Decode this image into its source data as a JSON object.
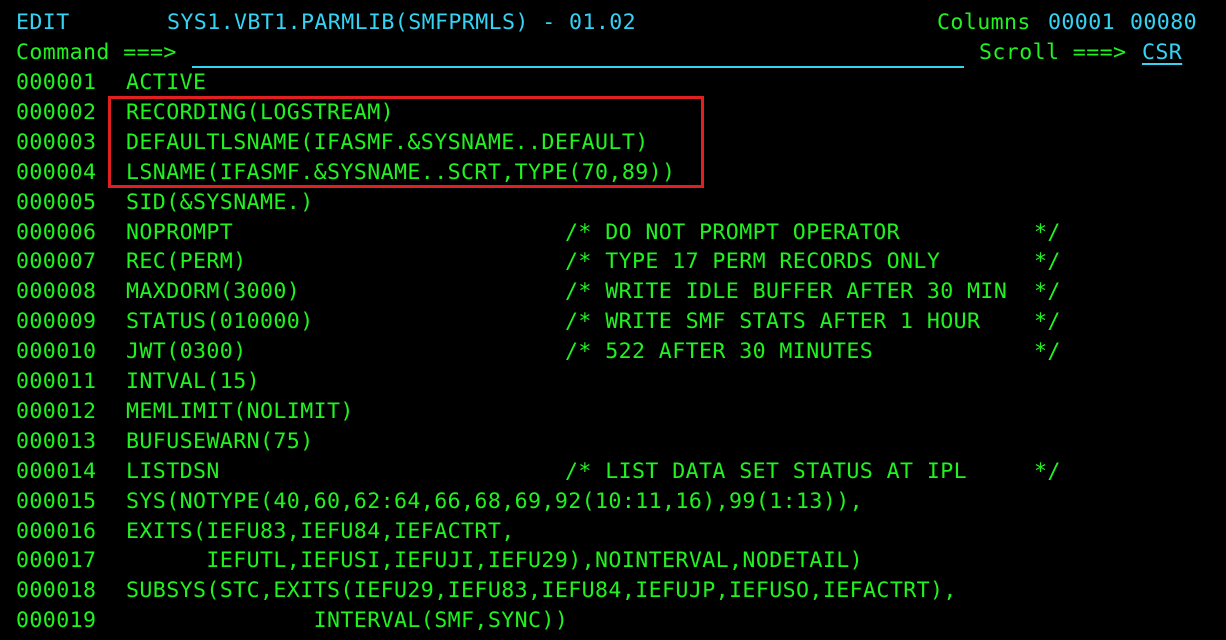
{
  "header": {
    "mode": "EDIT",
    "dataset": "SYS1.VBT1.PARMLIB(SMFPRMLS) - 01.02",
    "columns_label": "Columns",
    "col_start": "00001",
    "col_end": "00080"
  },
  "command_line": {
    "label": "Command ===>",
    "value": "",
    "scroll_label": "Scroll ===>",
    "scroll_value": "CSR"
  },
  "lines": [
    {
      "num": "000001",
      "text": "ACTIVE",
      "comment": ""
    },
    {
      "num": "000002",
      "text": "RECORDING(LOGSTREAM)",
      "comment": ""
    },
    {
      "num": "000003",
      "text": "DEFAULTLSNAME(IFASMF.&SYSNAME..DEFAULT)",
      "comment": ""
    },
    {
      "num": "000004",
      "text": "LSNAME(IFASMF.&SYSNAME..SCRT,TYPE(70,89))",
      "comment": ""
    },
    {
      "num": "000005",
      "text": "SID(&SYSNAME.)",
      "comment": ""
    },
    {
      "num": "000006",
      "text": "NOPROMPT",
      "comment": "/* DO NOT PROMPT OPERATOR          */"
    },
    {
      "num": "000007",
      "text": "REC(PERM)",
      "comment": "/* TYPE 17 PERM RECORDS ONLY       */"
    },
    {
      "num": "000008",
      "text": "MAXDORM(3000)",
      "comment": "/* WRITE IDLE BUFFER AFTER 30 MIN  */"
    },
    {
      "num": "000009",
      "text": "STATUS(010000)",
      "comment": "/* WRITE SMF STATS AFTER 1 HOUR    */"
    },
    {
      "num": "000010",
      "text": "JWT(0300)",
      "comment": "/* 522 AFTER 30 MINUTES            */"
    },
    {
      "num": "000011",
      "text": "INTVAL(15)",
      "comment": ""
    },
    {
      "num": "000012",
      "text": "MEMLIMIT(NOLIMIT)",
      "comment": ""
    },
    {
      "num": "000013",
      "text": "BUFUSEWARN(75)",
      "comment": ""
    },
    {
      "num": "000014",
      "text": "LISTDSN",
      "comment": "/* LIST DATA SET STATUS AT IPL     */"
    },
    {
      "num": "000015",
      "text": "SYS(NOTYPE(40,60,62:64,66,68,69,92(10:11,16),99(1:13)),",
      "comment": ""
    },
    {
      "num": "000016",
      "text": "EXITS(IEFU83,IEFU84,IEFACTRT,",
      "comment": ""
    },
    {
      "num": "000017",
      "text": "      IEFUTL,IEFUSI,IEFUJI,IEFU29),NOINTERVAL,NODETAIL)",
      "comment": ""
    },
    {
      "num": "000018",
      "text": "SUBSYS(STC,EXITS(IEFU29,IEFU83,IEFU84,IEFUJP,IEFUSO,IEFACTRT),",
      "comment": ""
    },
    {
      "num": "000019",
      "text": "              INTERVAL(SMF,SYNC))",
      "comment": ""
    }
  ],
  "colors": {
    "background": "#000000",
    "text_green": "#21f321",
    "text_cyan": "#35d3f4",
    "highlight_border": "#e02020"
  }
}
